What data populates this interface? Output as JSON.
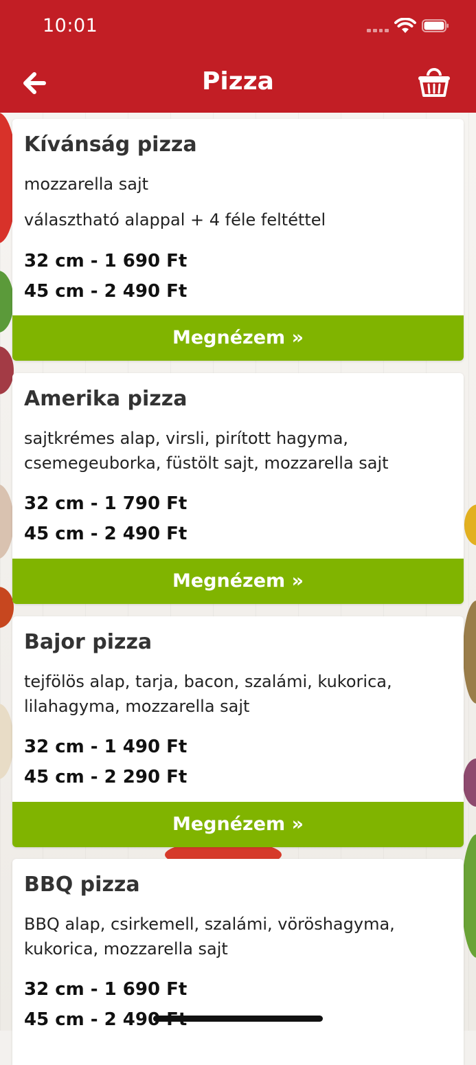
{
  "status_bar": {
    "time": "10:01"
  },
  "header": {
    "title": "Pizza"
  },
  "button_label": "Megnézem »",
  "products": [
    {
      "name": "Kívánság pizza",
      "description": [
        "mozzarella  sajt",
        "választható alappal + 4 féle feltéttel"
      ],
      "prices": [
        "32 cm - 1 690 Ft",
        "45 cm - 2 490 Ft"
      ]
    },
    {
      "name": "Amerika pizza",
      "description": [
        "sajtkrémes alap, virsli, pirított hagyma, csemegeuborka, füstölt sajt, mozzarella  sajt"
      ],
      "prices": [
        "32 cm - 1 790 Ft",
        "45 cm - 2 490 Ft"
      ]
    },
    {
      "name": "Bajor pizza",
      "description": [
        "tejfölös alap, tarja, bacon, szalámi, kukorica, lilahagyma, mozzarella  sajt"
      ],
      "prices": [
        "32 cm - 1 490 Ft",
        "45 cm - 2 290 Ft"
      ]
    },
    {
      "name": "BBQ pizza",
      "description": [
        "BBQ alap, csirkemell, szalámi, vöröshagyma, kukorica, mozzarella  sajt"
      ],
      "prices": [
        "32 cm - 1 690 Ft",
        "45 cm - 2 490 Ft"
      ]
    }
  ],
  "colors": {
    "header": "#c21e25",
    "button": "#80b400"
  },
  "icons": {
    "back": "arrow-left-icon",
    "cart": "basket-icon"
  }
}
